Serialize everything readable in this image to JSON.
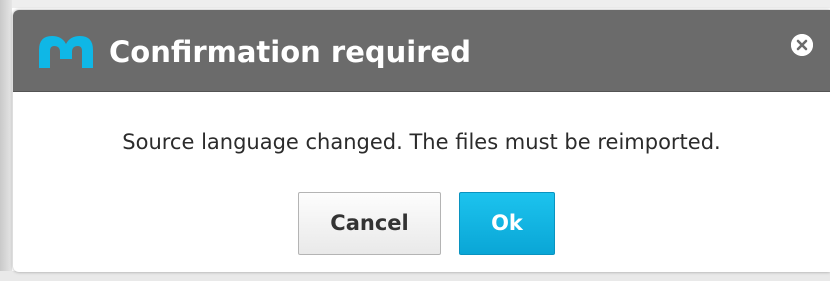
{
  "dialog": {
    "title": "Confirmation required",
    "logo_icon": "memsource-logo-icon",
    "close_icon": "close-circle-icon",
    "message": "Source language changed. The files must be reimported.",
    "buttons": {
      "cancel_label": "Cancel",
      "ok_label": "Ok"
    }
  },
  "colors": {
    "titlebar": "#6b6b6b",
    "logo": "#0fb7e6",
    "ok_button": "#10b2e2",
    "cancel_button": "#f2f2f2"
  }
}
